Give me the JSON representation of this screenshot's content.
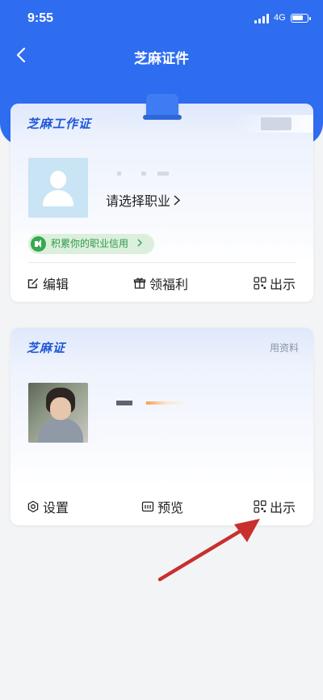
{
  "status": {
    "time": "9:55",
    "network": "4G"
  },
  "nav": {
    "title": "芝麻证件"
  },
  "work_card": {
    "title": "芝麻工作证",
    "choose_job": "请选择职业",
    "credit_pill": "积累你的职业信用",
    "actions": {
      "edit": "编辑",
      "benefits": "领福利",
      "show": "出示"
    }
  },
  "zhima_card": {
    "title": "芝麻证",
    "head_link": "用资料",
    "actions": {
      "settings": "设置",
      "preview": "预览",
      "show": "出示"
    }
  },
  "colors": {
    "brand_blue": "#2f6df0",
    "card_title": "#1f56d8",
    "credit_green": "#2e9a4c",
    "annotation_red": "#c8302d"
  },
  "annotation": {
    "icon": "red-arrow-icon",
    "points_to": "zhima_card.actions.show"
  }
}
